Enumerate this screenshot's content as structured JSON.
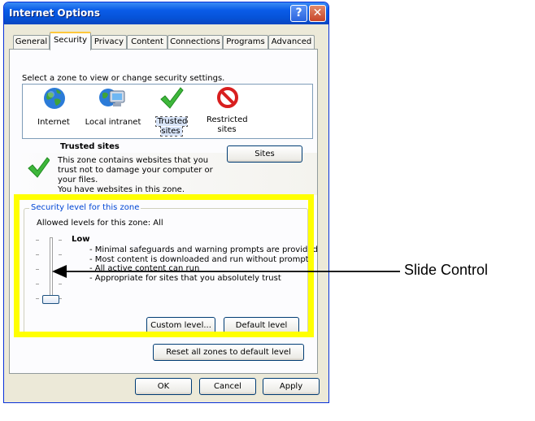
{
  "window": {
    "title": "Internet Options",
    "help_label": "?",
    "close_label": "✕"
  },
  "tabs": [
    {
      "label": "General"
    },
    {
      "label": "Security"
    },
    {
      "label": "Privacy"
    },
    {
      "label": "Content"
    },
    {
      "label": "Connections"
    },
    {
      "label": "Programs"
    },
    {
      "label": "Advanced"
    }
  ],
  "zones": {
    "instruction": "Select a zone to view or change security settings.",
    "items": [
      {
        "label": "Internet",
        "icon": "globe-icon"
      },
      {
        "label": "Local intranet",
        "icon": "intranet-icon"
      },
      {
        "label": "Trusted sites",
        "icon": "checkmark-icon"
      },
      {
        "label_line1": "Restricted",
        "label_line2": "sites",
        "icon": "restricted-icon"
      }
    ]
  },
  "selected_zone": {
    "title": "Trusted sites",
    "desc_line1": "This zone contains websites that you",
    "desc_line2": "trust not to damage your computer or",
    "desc_line3": "your files.",
    "desc_line4": "You have websites in this zone.",
    "sites_button": "Sites"
  },
  "security_level": {
    "group_title": "Security level for this zone",
    "allowed": "Allowed levels for this zone: All",
    "level": "Low",
    "bullet1": "- Minimal safeguards and warning prompts are provided",
    "bullet2": "- Most content is downloaded and run without prompts",
    "bullet3": "- All active content can run",
    "bullet4": "- Appropriate for sites that you absolutely trust",
    "custom_button": "Custom level...",
    "default_button": "Default level",
    "slider_level_fraction": 0
  },
  "reset_button": "Reset all zones to default level",
  "dialog_buttons": {
    "ok": "OK",
    "cancel": "Cancel",
    "apply": "Apply"
  },
  "annotation": {
    "label": "Slide Control",
    "highlight_color": "#ffff00"
  }
}
